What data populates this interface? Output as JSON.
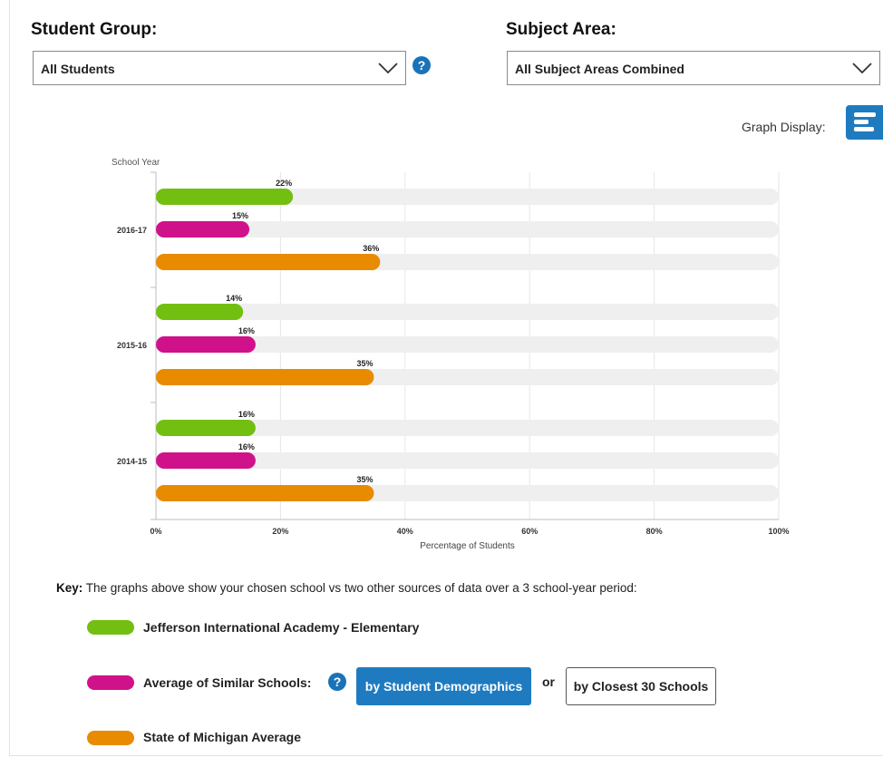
{
  "filters": {
    "student_group_label": "Student Group:",
    "student_group_value": "All Students",
    "subject_area_label": "Subject Area:",
    "subject_area_value": "All Subject Areas Combined",
    "help_glyph": "?"
  },
  "graph_display": {
    "label": "Graph Display:",
    "icon": "bar-list-icon"
  },
  "chart_data": {
    "type": "bar",
    "orientation": "horizontal",
    "ylabel": "School Year",
    "xlabel": "Percentage of Students",
    "categories": [
      "2016-17",
      "2015-16",
      "2014-15"
    ],
    "series": [
      {
        "name": "Jefferson International Academy - Elementary",
        "color": "#72bf12",
        "values": [
          22,
          14,
          16
        ]
      },
      {
        "name": "Average of Similar Schools:",
        "color": "#d0128a",
        "values": [
          15,
          16,
          16
        ]
      },
      {
        "name": "State of Michigan Average",
        "color": "#e88b00",
        "values": [
          36,
          35,
          35
        ]
      }
    ],
    "xlim": [
      0,
      100
    ],
    "xticks": [
      "0%",
      "20%",
      "40%",
      "60%",
      "80%",
      "100%"
    ],
    "value_suffix": "%",
    "track_color": "#efefef",
    "grid": true
  },
  "key": {
    "prefix": "Key:",
    "text": " The graphs above show your chosen school vs two other sources of data over a 3 school-year period:",
    "school_label": "Jefferson International Academy - Elementary",
    "similar_label": "Average of Similar Schools:",
    "state_label": "State of Michigan Average",
    "by_demographics": "by Student Demographics",
    "or": "or",
    "by_closest": "by Closest 30 Schools"
  }
}
